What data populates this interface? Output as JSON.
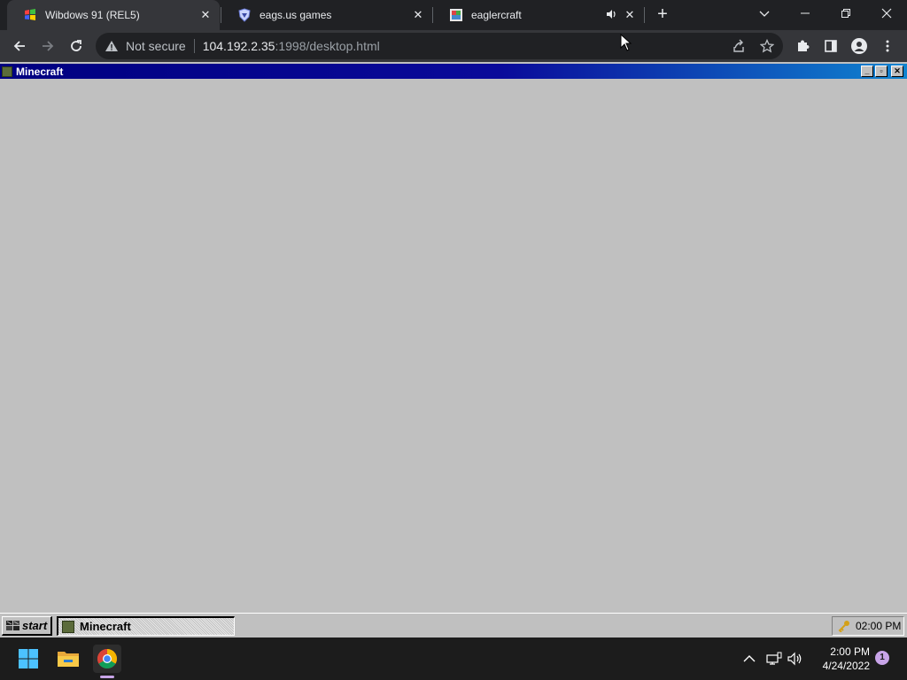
{
  "browser": {
    "tabs": [
      {
        "title": "Wibdows 91 (REL5)",
        "active": true,
        "favicon": "windows-flag-icon"
      },
      {
        "title": "eags.us games",
        "active": false,
        "favicon": "shield-icon"
      },
      {
        "title": "eaglercraft",
        "active": false,
        "favicon": "eaglercraft-icon",
        "audio": true
      }
    ],
    "address_bar": {
      "security_label": "Not secure",
      "url_host": "104.192.2.35",
      "url_rest": ":1998/desktop.html"
    },
    "colors": {
      "frame": "#202124",
      "toolbar": "#35363a",
      "text": "#e8eaed"
    }
  },
  "desktop": {
    "window": {
      "title": "Minecraft",
      "titlebar_start": "#000080",
      "titlebar_end": "#1084d0"
    },
    "taskbar": {
      "start_label": "start",
      "items": [
        {
          "label": "Minecraft"
        }
      ],
      "clock": "02:00 PM"
    },
    "background": "#c0c0c0"
  },
  "os_taskbar": {
    "pinned": [
      "windows-start-icon",
      "file-explorer-icon",
      "chrome-icon"
    ],
    "clock": {
      "time": "2:00 PM",
      "date": "4/24/2022"
    },
    "notification_count": "1"
  }
}
